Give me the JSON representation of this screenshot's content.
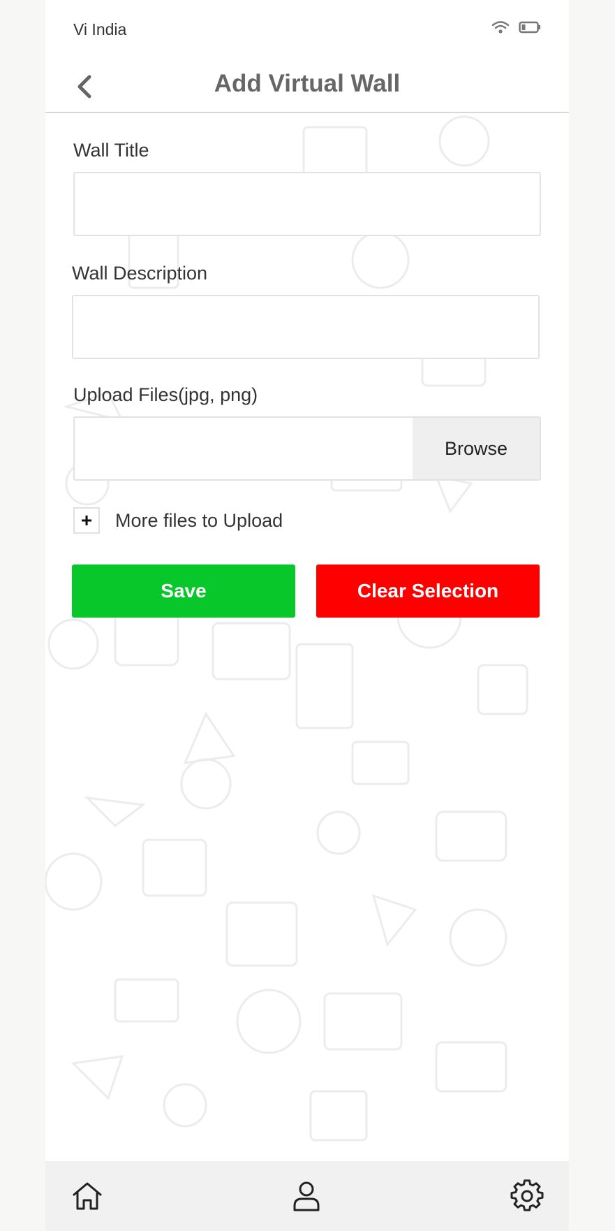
{
  "status_bar": {
    "carrier": "Vi India",
    "icons": [
      "wifi-icon",
      "battery-icon"
    ]
  },
  "header": {
    "back_icon": "chevron-left-icon",
    "title": "Add Virtual Wall"
  },
  "form": {
    "wall_title": {
      "label": "Wall Title",
      "value": "",
      "placeholder": ""
    },
    "wall_description": {
      "label": "Wall Description",
      "value": "",
      "placeholder": ""
    },
    "upload": {
      "label": "Upload Files(jpg, png)",
      "value": "",
      "browse_label": "Browse"
    },
    "more_files": {
      "icon": "+",
      "label": "More files to Upload"
    }
  },
  "actions": {
    "save_label": "Save",
    "clear_label": "Clear Selection"
  },
  "bottom_nav": {
    "items": [
      "home-icon",
      "profile-icon",
      "settings-icon"
    ]
  },
  "colors": {
    "save": "#08c72a",
    "clear": "#ff0000",
    "title": "#666666",
    "nav_background": "#f1f1f1"
  }
}
